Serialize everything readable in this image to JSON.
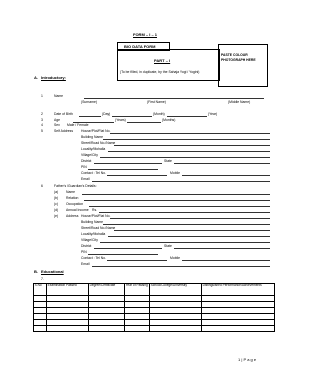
{
  "header": {
    "form_no": "FORM – I – 1",
    "title": "BIO DATA FORM",
    "part": "PART – I",
    "note": "(To be filled, in duplicate, by the Sahaja Yogi / Yogini)"
  },
  "photo": {
    "text": "PASTE COLOUR PHOTOGRAPH HERE"
  },
  "section_a": {
    "label": "A.",
    "title": "Introductory:",
    "rows": {
      "n1": "1",
      "name": "Name",
      "sub_surname": "(Surname)",
      "sub_first": "(First Name)",
      "sub_middle": "(Middle Name)",
      "n2": "2",
      "dob": "Date of Birth",
      "sub_day": "(Day)",
      "sub_month": "(Month)",
      "sub_year": "(Year)",
      "n3": "3",
      "age": "Age",
      "sub_years": "(Years)",
      "sub_months": "(Months)",
      "n4": "4",
      "sex": "Sex",
      "sex_value": "Male / Female",
      "n5": "5",
      "self_address": "Self Address",
      "house": "House/Plot/Flat No.",
      "building": "Building Name",
      "street": "Street/Road No./Name",
      "locality": "Locality/Mohalla",
      "village": "Village/City",
      "district": "District",
      "state": "State",
      "pin": "PIN",
      "contact": "Contact : Tel No.",
      "mobile": "Mobile",
      "email": "Email"
    }
  },
  "section_6": {
    "n6": "6",
    "title": "Father's /Guardian's Details:",
    "a": "(a)",
    "a_label": "Name",
    "b": "(b)",
    "b_label": "Relation",
    "c": "(c)",
    "c_label": "Occupation",
    "d": "(d)",
    "d_label": "Annual Income",
    "d_value": "Rs.",
    "e": "(e)",
    "e_label": "Address",
    "house": "House/Plot/Flat No.",
    "building": "Building Name",
    "street": "Street/Road No./Name",
    "locality": "Locality/Mohalla",
    "village": "Village/City",
    "district": "District",
    "state": "State",
    "pin": "PIN",
    "contact": "Contact : Tel No.",
    "mobile": "Mobile",
    "email": "Email"
  },
  "section_b": {
    "label": "B.",
    "title": "Educational",
    "n7": "7."
  },
  "edu_table": {
    "headers": [
      "S.No",
      "Examination Passed",
      "Degree/Certificate",
      "Year of Passing",
      "School/College/University",
      "Distinguished Performance/Achievements"
    ],
    "empty_rows": 6
  },
  "footer": {
    "page_num": "1",
    "page_label": "P a g e"
  }
}
